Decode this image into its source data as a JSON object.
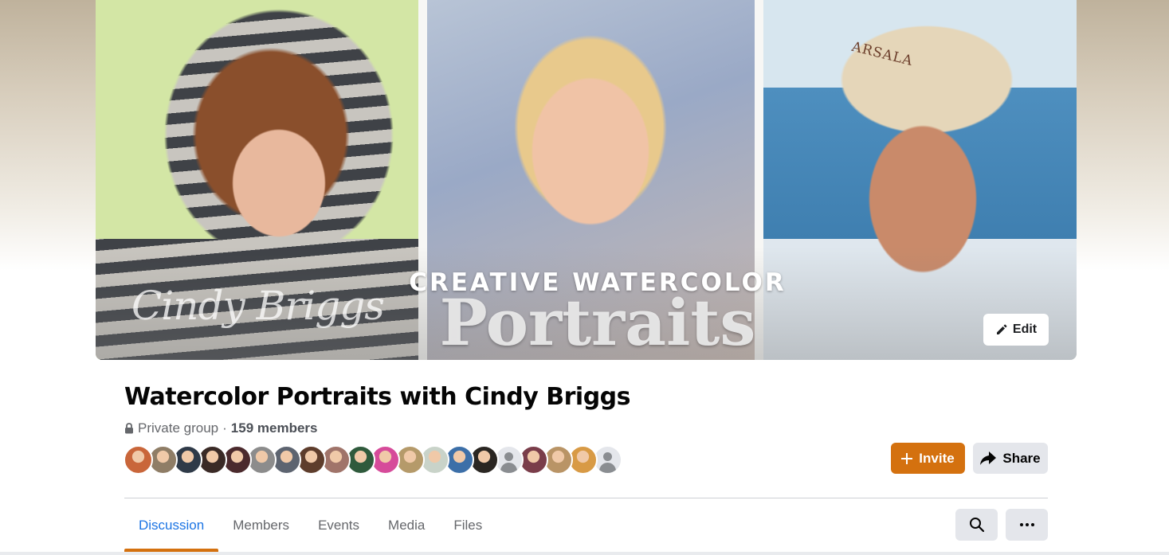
{
  "cover": {
    "title_top": "CREATIVE WATERCOLOR",
    "title_main": "Portraits",
    "signature": "Cindy Briggs",
    "hat_text": "ARSALA",
    "edit_label": "Edit"
  },
  "group": {
    "name": "Watercolor Portraits with Cindy Briggs",
    "privacy": "Private group",
    "separator": "·",
    "members_count": "159 members"
  },
  "avatars": [
    {
      "kind": "photo",
      "color": "#c9663a"
    },
    {
      "kind": "photo",
      "color": "#8f7d66"
    },
    {
      "kind": "photo",
      "color": "#2f3a48"
    },
    {
      "kind": "photo",
      "color": "#3a2a26"
    },
    {
      "kind": "photo",
      "color": "#4b2a2d"
    },
    {
      "kind": "photo",
      "color": "#8c8c8c"
    },
    {
      "kind": "photo",
      "color": "#5d6470"
    },
    {
      "kind": "photo",
      "color": "#5e3d2c"
    },
    {
      "kind": "photo",
      "color": "#a0746a"
    },
    {
      "kind": "photo",
      "color": "#2f5a3c"
    },
    {
      "kind": "photo",
      "color": "#d64b9a"
    },
    {
      "kind": "photo",
      "color": "#b59a6a"
    },
    {
      "kind": "photo",
      "color": "#c9d3c9"
    },
    {
      "kind": "photo",
      "color": "#3c6fa8"
    },
    {
      "kind": "photo",
      "color": "#2a2622"
    },
    {
      "kind": "placeholder",
      "color": "#e4e6eb"
    },
    {
      "kind": "photo",
      "color": "#7a3d4a"
    },
    {
      "kind": "photo",
      "color": "#b99466"
    },
    {
      "kind": "photo",
      "color": "#d89a45"
    },
    {
      "kind": "placeholder",
      "color": "#e4e6eb"
    }
  ],
  "actions": {
    "invite_label": "Invite",
    "share_label": "Share"
  },
  "tabs": [
    {
      "label": "Discussion",
      "active": true
    },
    {
      "label": "Members",
      "active": false
    },
    {
      "label": "Events",
      "active": false
    },
    {
      "label": "Media",
      "active": false
    },
    {
      "label": "Files",
      "active": false
    }
  ],
  "colors": {
    "accent": "#d4710f",
    "active_tab": "#1b74e4",
    "secondary_text": "#65676b",
    "button_bg": "#e4e6eb"
  }
}
